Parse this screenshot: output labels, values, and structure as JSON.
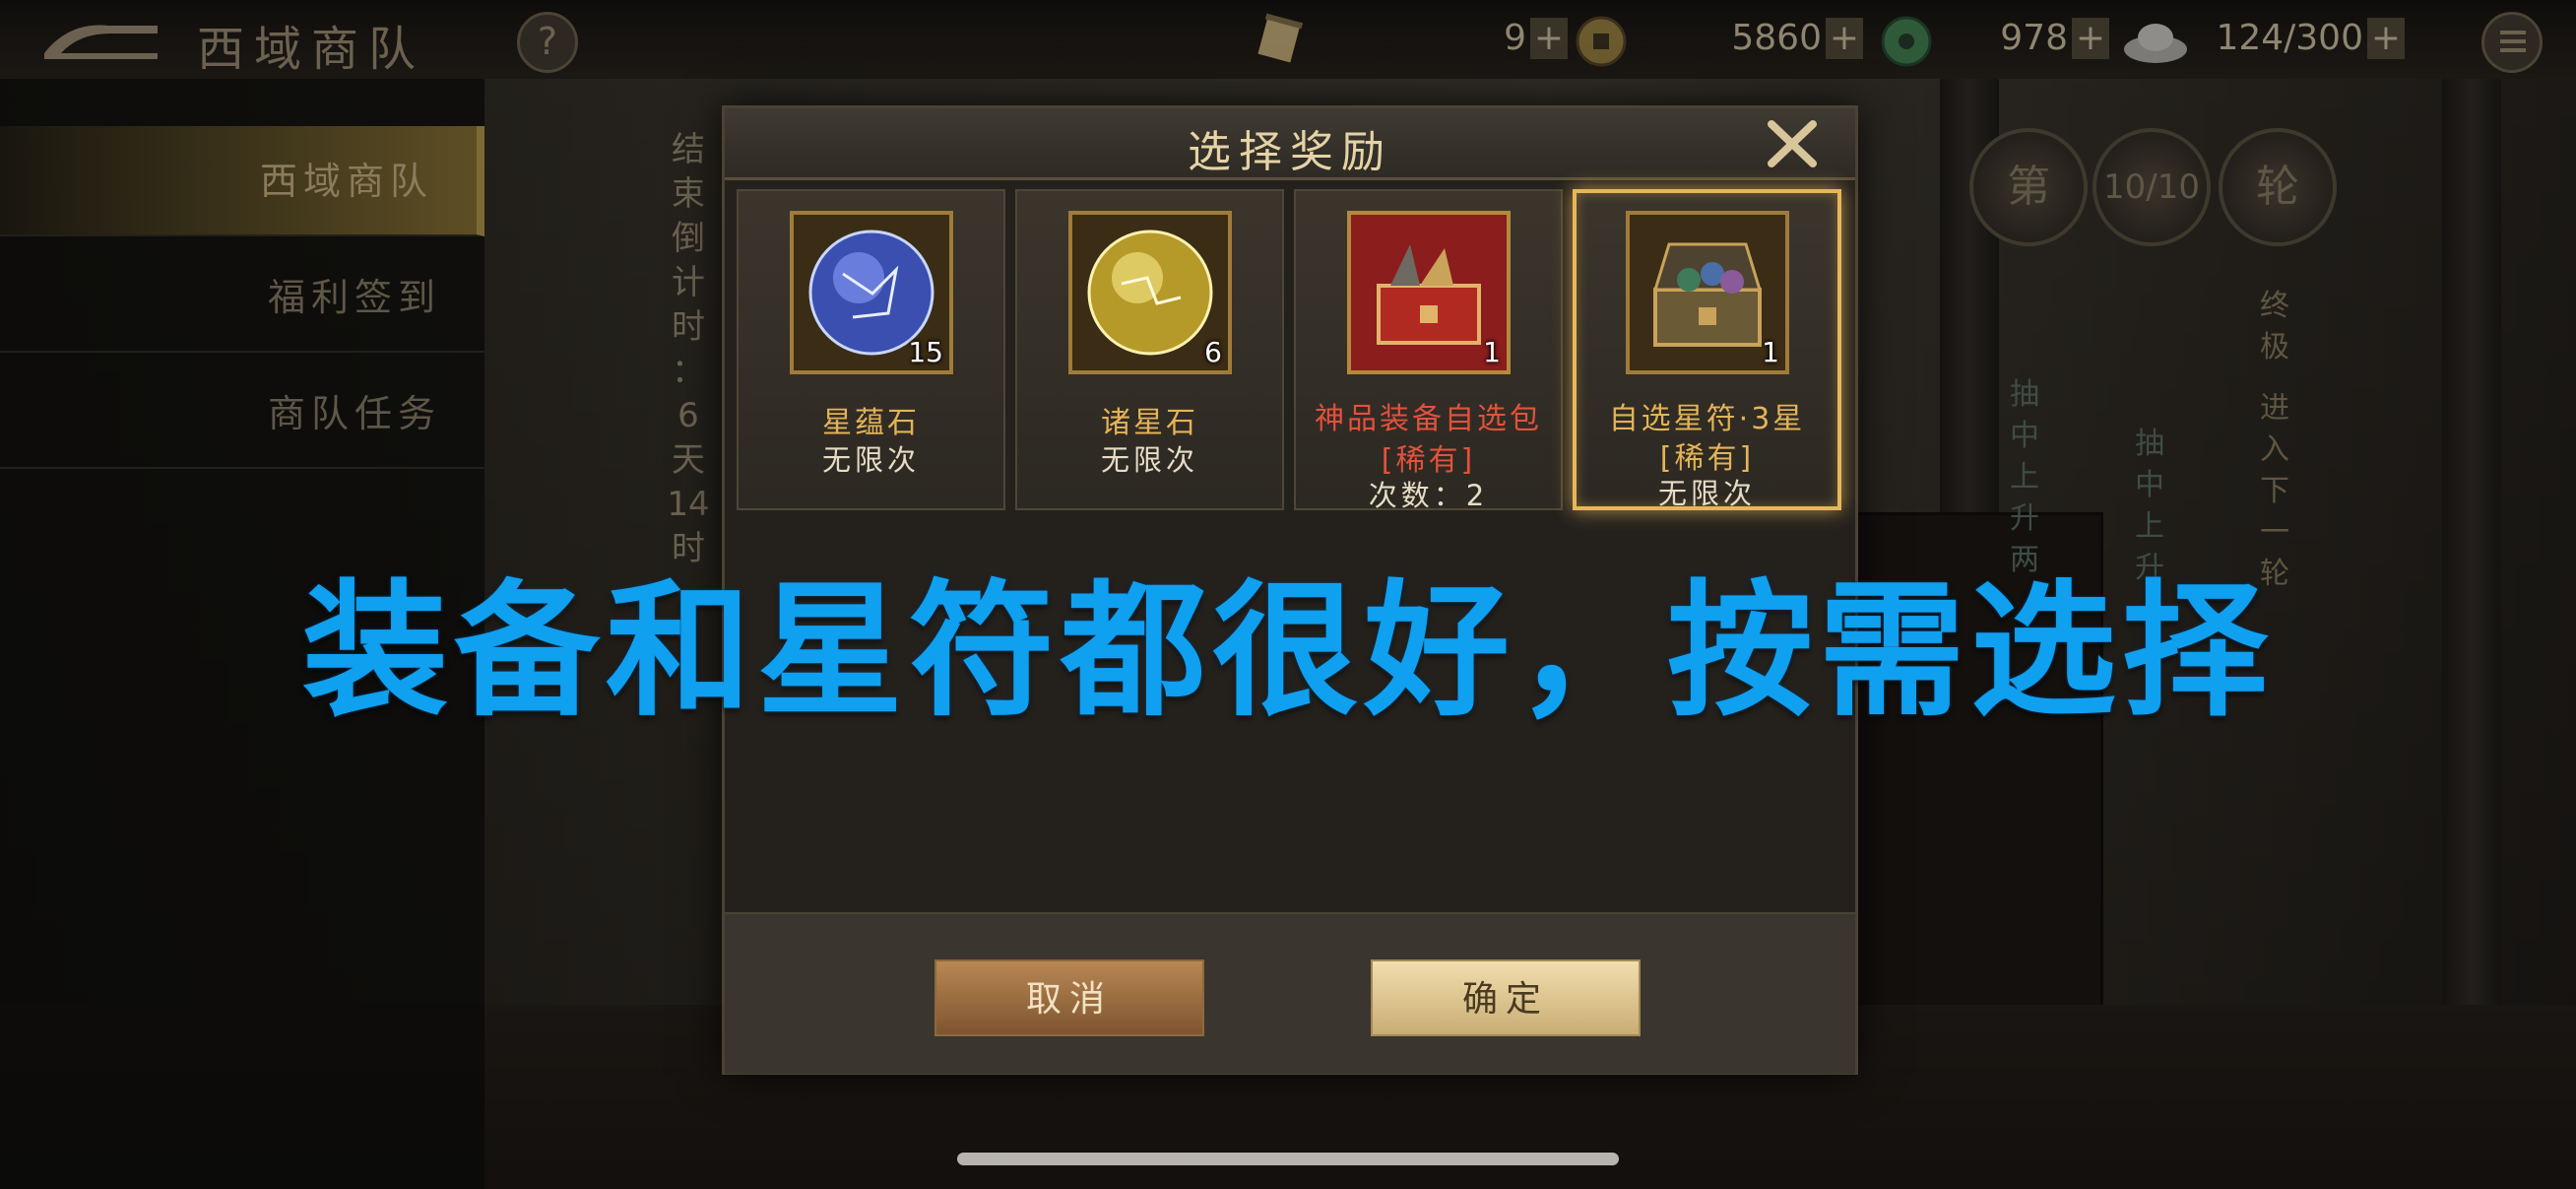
{
  "topbar": {
    "title": "西域商队",
    "help_label": "?",
    "resources": [
      {
        "icon": "scroll-icon",
        "value": "9",
        "plus": "+"
      },
      {
        "icon": "copper-coin-icon",
        "value": "5860",
        "plus": "+"
      },
      {
        "icon": "jade-coin-icon",
        "value": "978",
        "plus": "+"
      },
      {
        "icon": "silver-ingot-icon",
        "value": "124/300",
        "plus": "+"
      }
    ]
  },
  "sidebar": {
    "items": [
      {
        "label": "西域商队",
        "active": true
      },
      {
        "label": "福利签到",
        "active": false
      },
      {
        "label": "商队任务",
        "active": false
      }
    ]
  },
  "countdown": {
    "chars": [
      "结",
      "束",
      "倒",
      "计",
      "时",
      "：",
      "6",
      "天",
      "14",
      "时"
    ]
  },
  "round_info": {
    "prefix": "第",
    "value": "10/10",
    "suffix": "轮"
  },
  "ribbons": [
    {
      "text": [
        "抽",
        "中",
        "上",
        "升",
        "两"
      ]
    },
    {
      "text": [
        "抽",
        "中",
        "上",
        "升"
      ]
    },
    {
      "title": "终极",
      "text": [
        "进",
        "入",
        "下",
        "一",
        "轮"
      ]
    }
  ],
  "modal": {
    "title": "选择奖励",
    "cards": [
      {
        "name": "星蕴石",
        "quantity": "15",
        "limit": "无限次",
        "icon": "blue-star-orb-icon",
        "selected": false
      },
      {
        "name": "诸星石",
        "quantity": "6",
        "limit": "无限次",
        "icon": "gold-star-orb-icon",
        "selected": false
      },
      {
        "name": "神品装备自选包",
        "name2": "[稀有]",
        "quantity": "1",
        "limit": "次数：2",
        "icon": "red-equipment-chest-icon",
        "selected": false
      },
      {
        "name": "自选星符·3星",
        "name2": "[稀有]",
        "quantity": "1",
        "limit": "无限次",
        "icon": "star-rune-chest-icon",
        "selected": true
      }
    ],
    "cancel_label": "取消",
    "confirm_label": "确定"
  },
  "caption": "装备和星符都很好，按需选择",
  "colors": {
    "caption": "#0fa0f0",
    "selected_border": "#e5b65a",
    "rare_text": "#e3513c",
    "normal_name": "#e3b357"
  }
}
